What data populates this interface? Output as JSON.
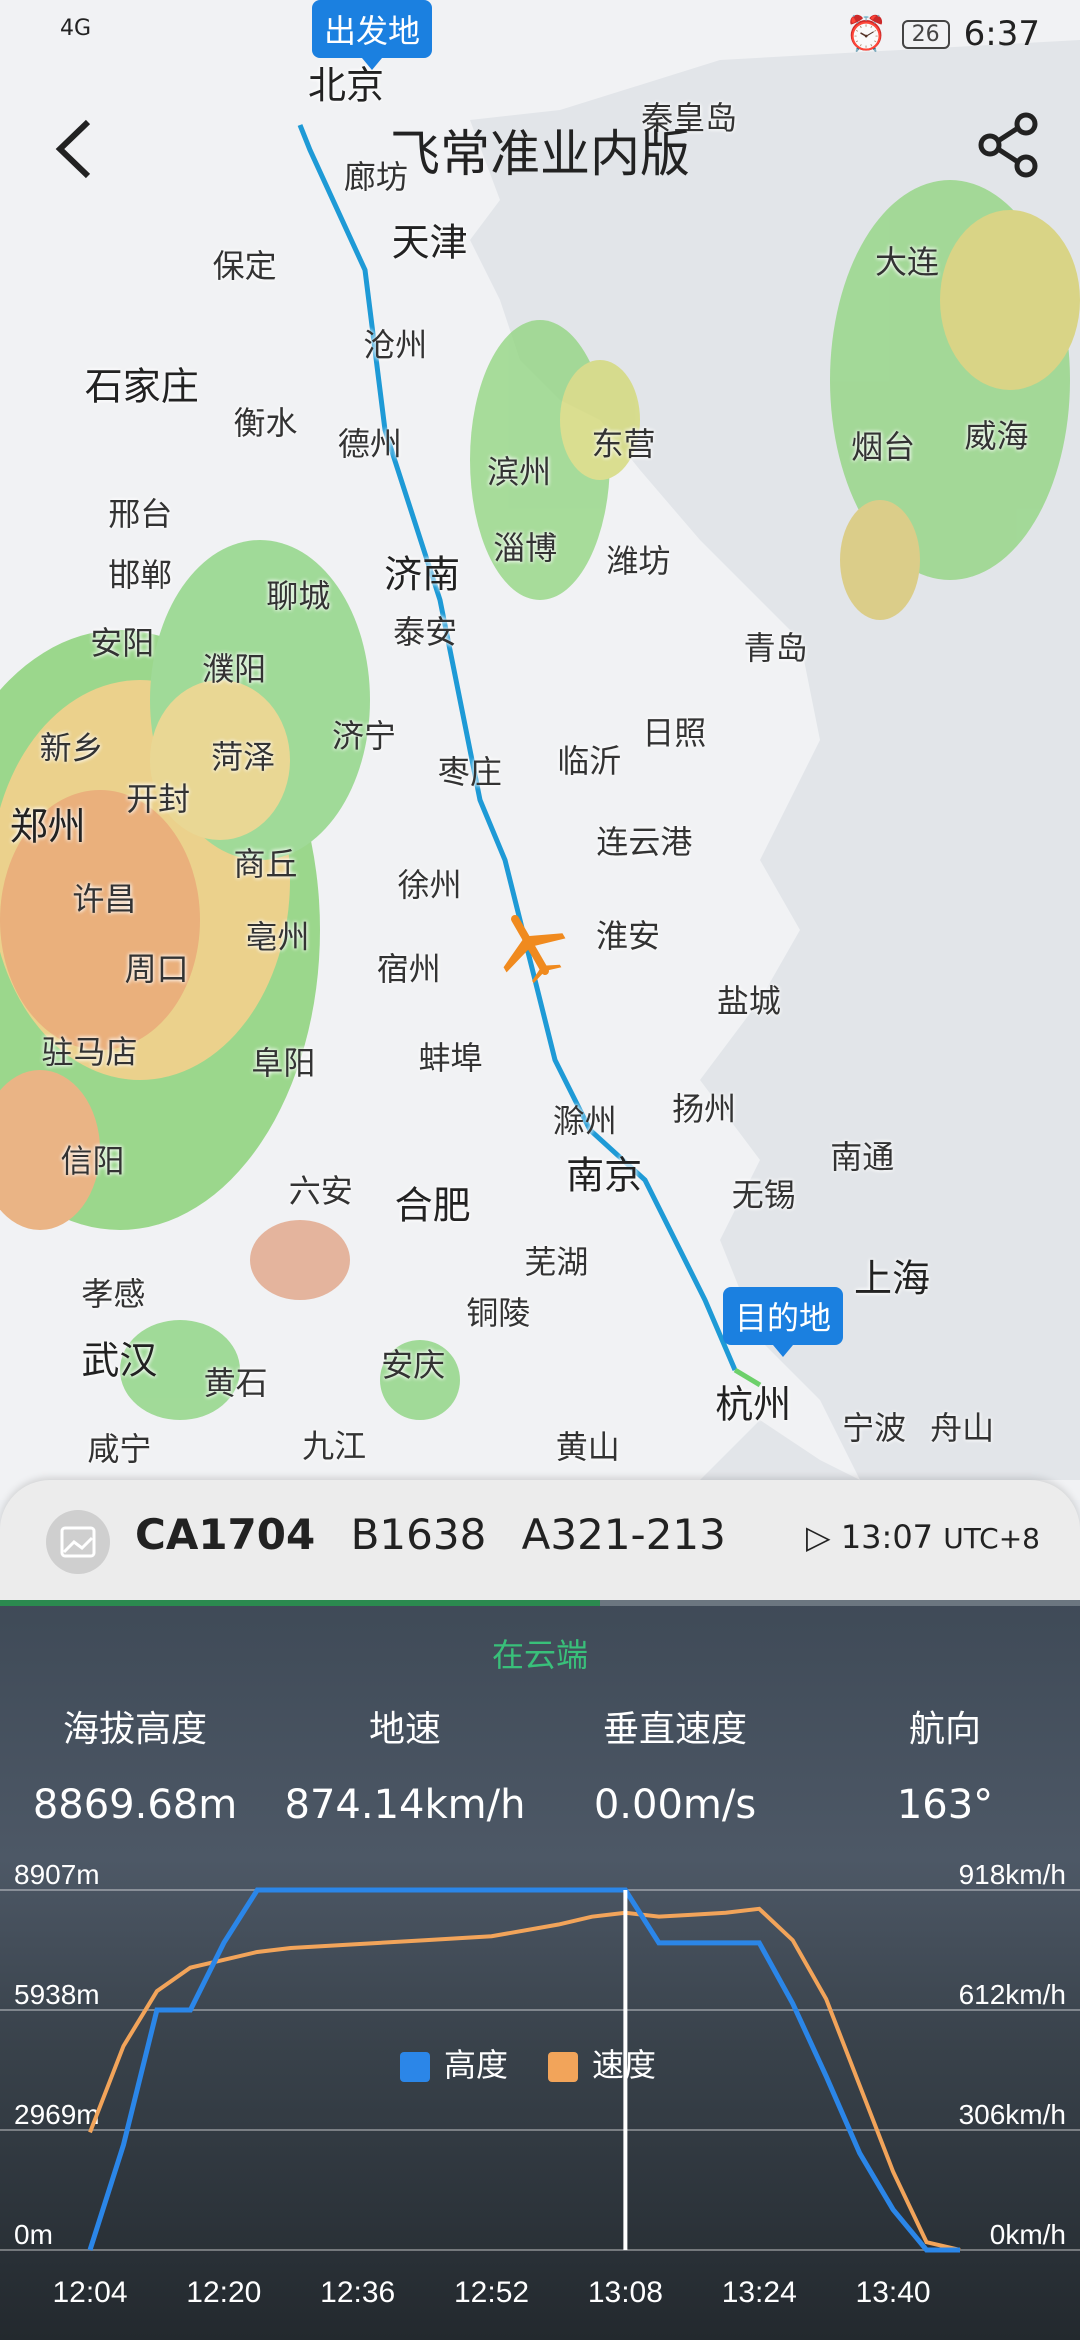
{
  "status": {
    "left": "4G",
    "time": "6:37",
    "battery": "26"
  },
  "header": {
    "title": "飞常准业内版"
  },
  "map": {
    "origin_tag": "出发地",
    "dest_tag": "目的地",
    "cities": [
      {
        "name": "北京",
        "x": 232,
        "y": 55,
        "big": true
      },
      {
        "name": "秦皇岛",
        "x": 462,
        "y": 78,
        "big": false
      },
      {
        "name": "廊坊",
        "x": 252,
        "y": 117,
        "big": false
      },
      {
        "name": "天津",
        "x": 288,
        "y": 160,
        "big": true
      },
      {
        "name": "大连",
        "x": 608,
        "y": 174,
        "big": false
      },
      {
        "name": "保定",
        "x": 164,
        "y": 177,
        "big": false
      },
      {
        "name": "沧州",
        "x": 265,
        "y": 230,
        "big": false
      },
      {
        "name": "石家庄",
        "x": 95,
        "y": 257,
        "big": true
      },
      {
        "name": "衡水",
        "x": 178,
        "y": 282,
        "big": false
      },
      {
        "name": "德州",
        "x": 248,
        "y": 296,
        "big": false
      },
      {
        "name": "东营",
        "x": 418,
        "y": 296,
        "big": false
      },
      {
        "name": "烟台",
        "x": 592,
        "y": 298,
        "big": false
      },
      {
        "name": "威海",
        "x": 668,
        "y": 291,
        "big": false
      },
      {
        "name": "滨州",
        "x": 348,
        "y": 315,
        "big": false
      },
      {
        "name": "邢台",
        "x": 94,
        "y": 343,
        "big": false
      },
      {
        "name": "淄博",
        "x": 352,
        "y": 366,
        "big": false
      },
      {
        "name": "潍坊",
        "x": 428,
        "y": 375,
        "big": false
      },
      {
        "name": "济南",
        "x": 283,
        "y": 383,
        "big": true
      },
      {
        "name": "邯郸",
        "x": 94,
        "y": 384,
        "big": false
      },
      {
        "name": "聊城",
        "x": 200,
        "y": 398,
        "big": false
      },
      {
        "name": "泰安",
        "x": 285,
        "y": 422,
        "big": false
      },
      {
        "name": "安阳",
        "x": 82,
        "y": 430,
        "big": false
      },
      {
        "name": "青岛",
        "x": 520,
        "y": 433,
        "big": false
      },
      {
        "name": "濮阳",
        "x": 157,
        "y": 447,
        "big": false
      },
      {
        "name": "济宁",
        "x": 244,
        "y": 492,
        "big": false
      },
      {
        "name": "日照",
        "x": 452,
        "y": 490,
        "big": false
      },
      {
        "name": "新乡",
        "x": 48,
        "y": 500,
        "big": false
      },
      {
        "name": "菏泽",
        "x": 163,
        "y": 506,
        "big": false
      },
      {
        "name": "临沂",
        "x": 395,
        "y": 509,
        "big": false
      },
      {
        "name": "枣庄",
        "x": 315,
        "y": 516,
        "big": false
      },
      {
        "name": "开封",
        "x": 106,
        "y": 534,
        "big": false
      },
      {
        "name": "郑州",
        "x": 32,
        "y": 552,
        "big": true
      },
      {
        "name": "连云港",
        "x": 432,
        "y": 563,
        "big": false
      },
      {
        "name": "商丘",
        "x": 178,
        "y": 578,
        "big": false
      },
      {
        "name": "徐州",
        "x": 288,
        "y": 592,
        "big": false
      },
      {
        "name": "许昌",
        "x": 70,
        "y": 601,
        "big": false
      },
      {
        "name": "亳州",
        "x": 186,
        "y": 627,
        "big": false
      },
      {
        "name": "淮安",
        "x": 421,
        "y": 626,
        "big": false
      },
      {
        "name": "周口",
        "x": 105,
        "y": 648,
        "big": false
      },
      {
        "name": "宿州",
        "x": 274,
        "y": 648,
        "big": false
      },
      {
        "name": "盐城",
        "x": 502,
        "y": 670,
        "big": false
      },
      {
        "name": "驻马店",
        "x": 60,
        "y": 704,
        "big": false
      },
      {
        "name": "阜阳",
        "x": 190,
        "y": 711,
        "big": false
      },
      {
        "name": "蚌埠",
        "x": 302,
        "y": 708,
        "big": false
      },
      {
        "name": "扬州",
        "x": 472,
        "y": 742,
        "big": false
      },
      {
        "name": "滁州",
        "x": 392,
        "y": 750,
        "big": false
      },
      {
        "name": "信阳",
        "x": 62,
        "y": 777,
        "big": false
      },
      {
        "name": "南通",
        "x": 578,
        "y": 774,
        "big": false
      },
      {
        "name": "南京",
        "x": 405,
        "y": 786,
        "big": true
      },
      {
        "name": "六安",
        "x": 215,
        "y": 797,
        "big": false
      },
      {
        "name": "无锡",
        "x": 512,
        "y": 800,
        "big": false
      },
      {
        "name": "合肥",
        "x": 290,
        "y": 806,
        "big": true
      },
      {
        "name": "芜湖",
        "x": 373,
        "y": 845,
        "big": false
      },
      {
        "name": "上海",
        "x": 598,
        "y": 855,
        "big": true
      },
      {
        "name": "孝感",
        "x": 76,
        "y": 866,
        "big": false
      },
      {
        "name": "铜陵",
        "x": 334,
        "y": 879,
        "big": false
      },
      {
        "name": "武汉",
        "x": 80,
        "y": 910,
        "big": true
      },
      {
        "name": "安庆",
        "x": 277,
        "y": 914,
        "big": false
      },
      {
        "name": "黄石",
        "x": 158,
        "y": 926,
        "big": false
      },
      {
        "name": "杭州",
        "x": 505,
        "y": 939,
        "big": true
      },
      {
        "name": "宁波",
        "x": 586,
        "y": 956,
        "big": false
      },
      {
        "name": "舟山",
        "x": 645,
        "y": 956,
        "big": false
      },
      {
        "name": "咸宁",
        "x": 80,
        "y": 970,
        "big": false
      },
      {
        "name": "九江",
        "x": 224,
        "y": 968,
        "big": false
      },
      {
        "name": "黄山",
        "x": 394,
        "y": 969,
        "big": false
      }
    ]
  },
  "flight": {
    "number": "CA1704",
    "reg": "B1638",
    "type": "A321-213",
    "time": "13:07",
    "tz": "UTC+8"
  },
  "phase": "在云端",
  "stats": [
    {
      "label": "海拔高度",
      "value": "8869.68m"
    },
    {
      "label": "地速",
      "value": "874.14km/h"
    },
    {
      "label": "垂直速度",
      "value": "0.00m/s"
    },
    {
      "label": "航向",
      "value": "163°"
    }
  ],
  "legend": {
    "altitude": "高度",
    "speed": "速度"
  },
  "colors": {
    "altitude": "#2b86e8",
    "speed": "#f2a45a",
    "route": "#1e9ad6",
    "tag": "#1b80e0"
  },
  "chart_data": {
    "type": "line",
    "x": [
      "12:04",
      "12:08",
      "12:12",
      "12:16",
      "12:20",
      "12:24",
      "12:28",
      "12:36",
      "12:44",
      "12:52",
      "13:00",
      "13:04",
      "13:08",
      "13:12",
      "13:16",
      "13:20",
      "13:24",
      "13:28",
      "13:32",
      "13:36",
      "13:40",
      "13:44",
      "13:48"
    ],
    "x_ticks": [
      "12:04",
      "12:20",
      "12:36",
      "12:52",
      "13:08",
      "13:24",
      "13:40"
    ],
    "series": [
      {
        "name": "高度",
        "values": [
          0,
          2600,
          5938,
          5938,
          7600,
          8907,
          8907,
          8907,
          8907,
          8907,
          8907,
          8907,
          8907,
          7600,
          7600,
          7600,
          7600,
          6100,
          4300,
          2400,
          1000,
          0,
          0
        ]
      },
      {
        "name": "速度",
        "values": [
          300,
          520,
          660,
          720,
          740,
          760,
          770,
          780,
          790,
          800,
          830,
          850,
          860,
          850,
          855,
          860,
          870,
          790,
          640,
          420,
          200,
          20,
          0
        ]
      }
    ],
    "y_left_ticks": [
      "0m",
      "2969m",
      "5938m",
      "8907m"
    ],
    "y_right_ticks": [
      "0km/h",
      "306km/h",
      "612km/h",
      "918km/h"
    ],
    "ylim_left": [
      0,
      8907
    ],
    "ylim_right": [
      0,
      918
    ],
    "current_x": "13:08"
  }
}
